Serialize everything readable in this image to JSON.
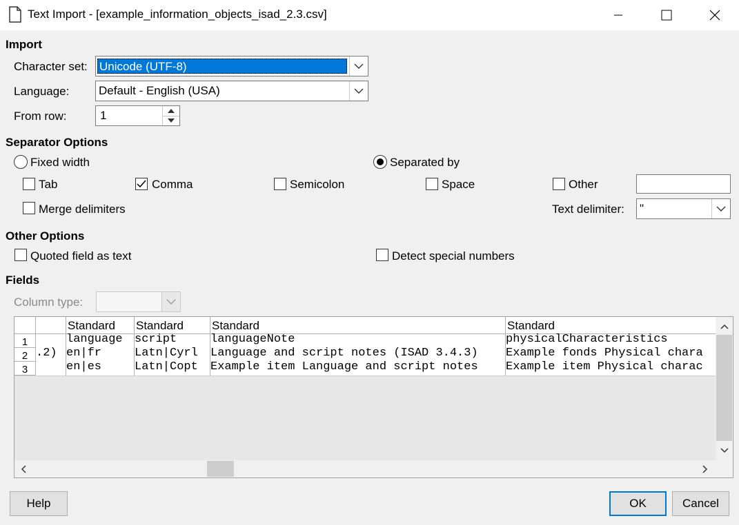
{
  "window": {
    "title": "Text Import - [example_information_objects_isad_2.3.csv]"
  },
  "import": {
    "section_title": "Import",
    "charset_label": "Character set:",
    "charset_value": "Unicode (UTF-8)",
    "language_label": "Language:",
    "language_value": "Default - English (USA)",
    "from_row_label": "From row:",
    "from_row_value": "1"
  },
  "separator": {
    "section_title": "Separator Options",
    "fixed_width": "Fixed width",
    "separated_by": "Separated by",
    "tab": "Tab",
    "comma": "Comma",
    "semicolon": "Semicolon",
    "space": "Space",
    "other": "Other",
    "other_value": "",
    "merge": "Merge delimiters",
    "text_delimiter_label": "Text delimiter:",
    "text_delimiter_value": "\""
  },
  "other_options": {
    "section_title": "Other Options",
    "quoted": "Quoted field as text",
    "detect": "Detect special numbers"
  },
  "fields": {
    "section_title": "Fields",
    "column_type_label": "Column type:",
    "headers": [
      "Standard",
      "Standard",
      "Standard",
      "Standard"
    ],
    "rows": [
      {
        "num": "1",
        "c0": "",
        "c1": "language",
        "c2": "script",
        "c3": "languageNote",
        "c4": "physicalCharacteristics"
      },
      {
        "num": "2",
        "c0": ".2)",
        "c1": "en|fr",
        "c2": "Latn|Cyrl",
        "c3": "Language and script notes (ISAD 3.4.3)",
        "c4": "Example fonds Physical chara"
      },
      {
        "num": "3",
        "c0": "",
        "c1": "en|es",
        "c2": "Latn|Copt",
        "c3": "Example item Language and script notes",
        "c4": "Example item Physical charac"
      }
    ]
  },
  "buttons": {
    "help": "Help",
    "ok": "OK",
    "cancel": "Cancel"
  },
  "colors": {
    "selection": "#0078d7",
    "ok_border": "#0078d7"
  }
}
